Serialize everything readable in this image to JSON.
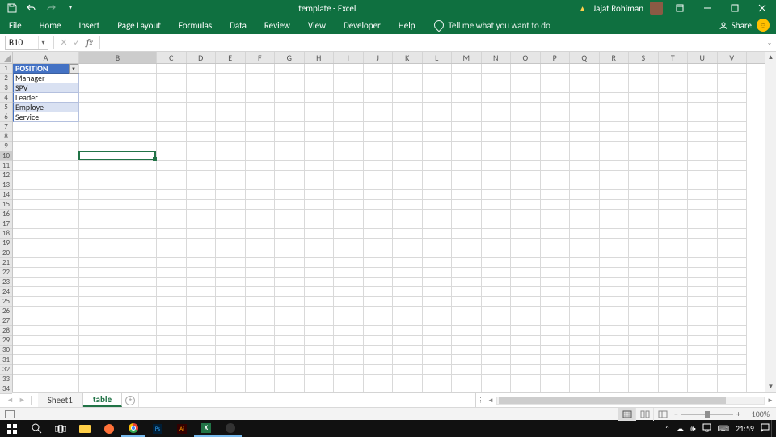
{
  "title": "template  -  Excel",
  "user_name": "Jajat Rohiman",
  "ribbon": {
    "tabs": [
      "File",
      "Home",
      "Insert",
      "Page Layout",
      "Formulas",
      "Data",
      "Review",
      "View",
      "Developer",
      "Help"
    ],
    "tell_me": "Tell me what you want to do",
    "share": "Share"
  },
  "formula_bar": {
    "name_box": "B10",
    "cancel": "✕",
    "confirm": "✓",
    "fx": "fx",
    "value": ""
  },
  "columns": [
    "A",
    "B",
    "C",
    "D",
    "E",
    "F",
    "G",
    "H",
    "I",
    "J",
    "K",
    "L",
    "M",
    "N",
    "O",
    "P",
    "Q",
    "R",
    "S",
    "T",
    "U",
    "V"
  ],
  "active_col": "B",
  "row_count": 34,
  "active_row": 10,
  "table": {
    "header": "POSITION",
    "rows": [
      "Manager",
      "SPV",
      "Leader",
      "Employe",
      "Service"
    ]
  },
  "sheet_tabs": {
    "inactive": "Sheet1",
    "active": "table"
  },
  "status": {
    "zoom": "100%"
  },
  "taskbar": {
    "time": "21:59",
    "ps": "Ps",
    "ai": "Ai",
    "xl": "X"
  }
}
